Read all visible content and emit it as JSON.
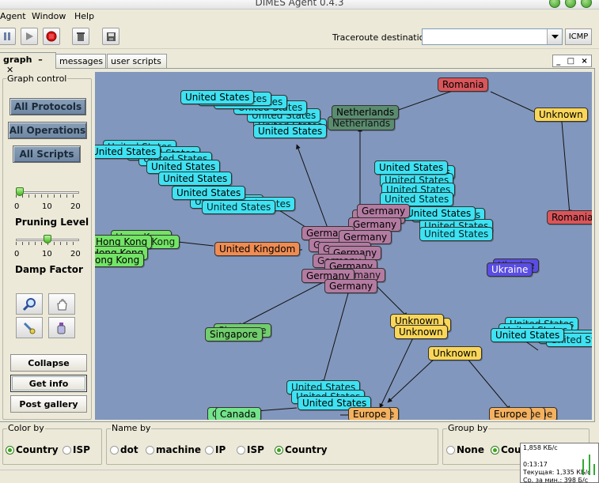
{
  "window": {
    "title": "DIMES Agent 0.4.3"
  },
  "menu": {
    "items": [
      "Agent",
      "Window",
      "Help"
    ]
  },
  "toolbar": {
    "traceroute_label": "Traceroute destination:",
    "traceroute_value": "",
    "icmp_label": "ICMP",
    "icons": [
      "pause-icon",
      "play-icon",
      "stop-icon",
      "trash-icon",
      "save-icon"
    ]
  },
  "tabs": [
    {
      "label": "graph",
      "active": true
    },
    {
      "label": "messages",
      "active": false
    },
    {
      "label": "user scripts",
      "active": false
    }
  ],
  "window_controls": {
    "minimize": "_",
    "maximize": "□",
    "close": "×"
  },
  "graph_control": {
    "legend": "Graph control",
    "buttons": [
      "All Protocols",
      "All Operations",
      "All Scripts"
    ],
    "pruning": {
      "title": "Pruning Level",
      "min": "0",
      "mid": "10",
      "max": "20",
      "value": 0
    },
    "damp": {
      "title": "Damp Factor",
      "min": "0",
      "mid": "10",
      "max": "20",
      "value": 10
    },
    "tools": [
      "zoom-icon",
      "hand-icon",
      "brush-icon",
      "bottle-icon"
    ],
    "collapse": "Collapse",
    "get_info": "Get info",
    "post_gallery": "Post gallery"
  },
  "graph": {
    "labels": {
      "us": "United States",
      "de": "Germany",
      "unk": "Unknown",
      "ro": "Romania",
      "nl": "Netherlands",
      "uk": "United Kingdom",
      "hk": "Hong Kong",
      "sg": "Singapore",
      "ua": "Ukraine",
      "eu": "Europe",
      "ca": "Canada"
    },
    "colors": {
      "background": "#8297bd",
      "us": "#3ee2f2",
      "de": "#b37ba1",
      "unk": "#f9d659",
      "ro": "#d9555a",
      "nl": "#5c8c70",
      "uk": "#f08c52",
      "hk": "#73e466",
      "sg": "#71cd6d",
      "ua": "#5a4de3",
      "eu": "#f4b15f",
      "ca": "#73e48a"
    }
  },
  "color_by": {
    "legend": "Color by",
    "options": [
      "Country",
      "ISP"
    ],
    "selected": "Country"
  },
  "name_by": {
    "legend": "Name by",
    "options": [
      "dot",
      "machine",
      "IP",
      "ISP",
      "Country"
    ],
    "selected": "Country"
  },
  "group_by": {
    "legend": "Group by",
    "options": [
      "None",
      "Country"
    ],
    "selected": "Country"
  },
  "net_monitor": {
    "rate": "1,858 КБ/с",
    "time": "0:13:17",
    "current": "Текущая: 1,335 КБ/с",
    "average": "Ср. за мин.: 398 Б/с"
  }
}
